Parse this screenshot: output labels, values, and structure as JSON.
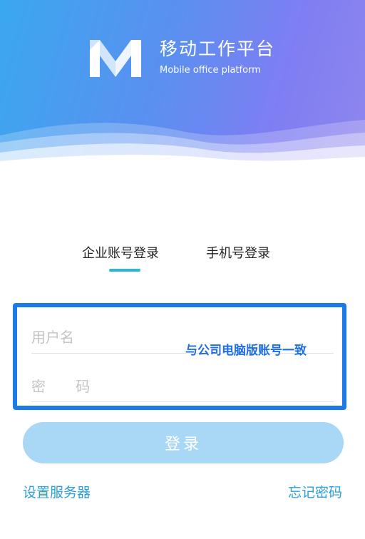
{
  "header": {
    "title": "移动工作平台",
    "subtitle": "Mobile office platform",
    "logo_icon": "m-logo-icon"
  },
  "tabs": [
    {
      "label": "企业账号登录",
      "active": true
    },
    {
      "label": "手机号登录",
      "active": false
    }
  ],
  "form": {
    "username_placeholder": "用户名",
    "password_placeholder": "密 码",
    "hint": "与公司电脑版账号一致"
  },
  "login_button": "登录",
  "links": {
    "settings": "设置服务器",
    "forgot": "忘记密码"
  },
  "colors": {
    "accent": "#2ab6e0",
    "highlight_border": "#1b7be8",
    "button": "#a9d8f7",
    "link": "#2a9fdc"
  }
}
